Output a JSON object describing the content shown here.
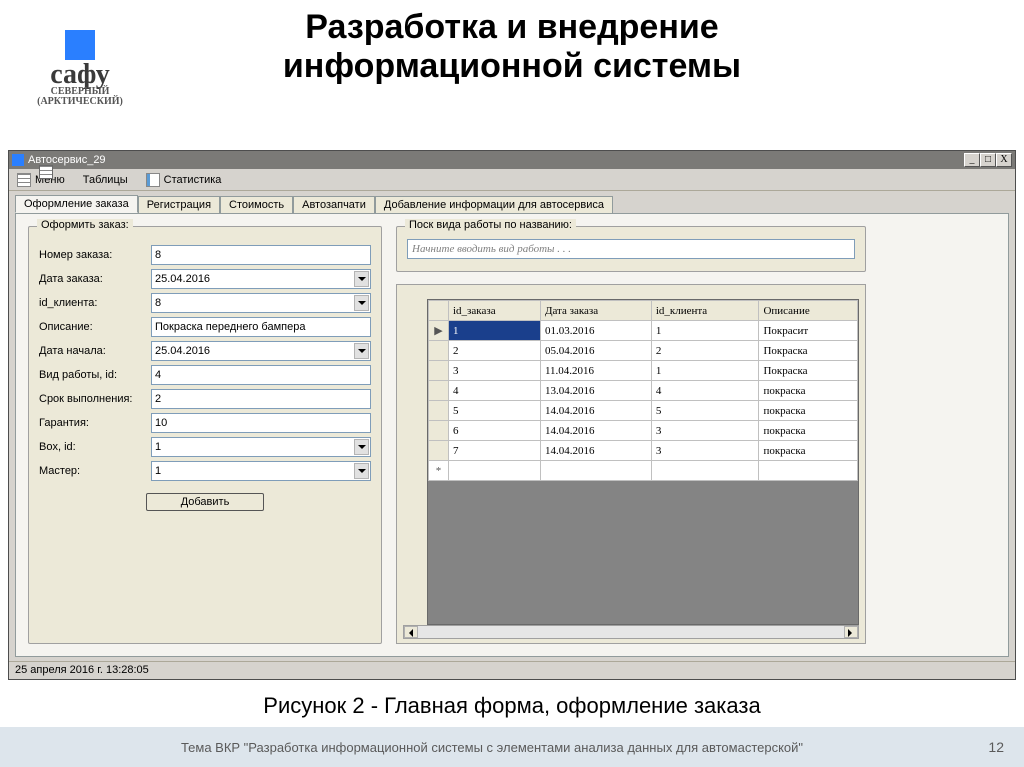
{
  "slide": {
    "title_line1": "Разработка и внедрение",
    "title_line2": "информационной системы",
    "caption": "Рисунок 2 - Главная форма, оформление заказа",
    "footer_topic": "Тема ВКР \"Разработка информационной системы с элементами анализа данных для автомастерской\"",
    "page_number": "12",
    "logo": {
      "brand": "сафу",
      "sub1": "СЕВЕРНЫЙ",
      "sub2": "(АРКТИЧЕСКИЙ)"
    }
  },
  "window": {
    "title": "Автосервис_29",
    "controls": {
      "min": "_",
      "max": "□",
      "close": "X"
    },
    "menu": {
      "items": [
        {
          "label": "Меню",
          "icon": "list"
        },
        {
          "label": "Таблицы",
          "icon": "grid"
        },
        {
          "label": "Статистика",
          "icon": "chart"
        }
      ]
    },
    "tabs": [
      {
        "label": "Оформление заказа",
        "active": true
      },
      {
        "label": "Регистрация",
        "active": false
      },
      {
        "label": "Стоимость",
        "active": false
      },
      {
        "label": "Автозапчати",
        "active": false
      },
      {
        "label": "Добавление информации для автосервиса",
        "active": false
      }
    ],
    "form": {
      "legend": "Оформить заказ:",
      "rows": [
        {
          "label": "Номер заказа:",
          "value": "8",
          "dropdown": false
        },
        {
          "label": "Дата заказа:",
          "value": "25.04.2016",
          "dropdown": true
        },
        {
          "label": "id_клиента:",
          "value": "8",
          "dropdown": true
        },
        {
          "label": "Описание:",
          "value": "Покраска переднего бампера",
          "dropdown": false
        },
        {
          "label": "Дата начала:",
          "value": "25.04.2016",
          "dropdown": true
        },
        {
          "label": "Вид работы, id:",
          "value": "4",
          "dropdown": false
        },
        {
          "label": "Срок выполнения:",
          "value": "2",
          "dropdown": false
        },
        {
          "label": "Гарантия:",
          "value": "10",
          "dropdown": false
        },
        {
          "label": "Box, id:",
          "value": "1",
          "dropdown": true
        },
        {
          "label": "Мастер:",
          "value": "1",
          "dropdown": true
        }
      ],
      "submit_label": "Добавить"
    },
    "search": {
      "legend": "Поск вида работы по названию:",
      "placeholder": "Начните вводить вид работы . . ."
    },
    "grid": {
      "headers": [
        "",
        "id_заказа",
        "Дата заказа",
        "id_клиента",
        "Описание"
      ],
      "rows": [
        {
          "marker": "▶",
          "id": "1",
          "date": "01.03.2016",
          "client": "1",
          "desc": "Покрасит",
          "selected": true
        },
        {
          "marker": "",
          "id": "2",
          "date": "05.04.2016",
          "client": "2",
          "desc": "Покраска"
        },
        {
          "marker": "",
          "id": "3",
          "date": "11.04.2016",
          "client": "1",
          "desc": "Покраска"
        },
        {
          "marker": "",
          "id": "4",
          "date": "13.04.2016",
          "client": "4",
          "desc": "покраска"
        },
        {
          "marker": "",
          "id": "5",
          "date": "14.04.2016",
          "client": "5",
          "desc": "покраска"
        },
        {
          "marker": "",
          "id": "6",
          "date": "14.04.2016",
          "client": "3",
          "desc": "покраска"
        },
        {
          "marker": "",
          "id": "7",
          "date": "14.04.2016",
          "client": "3",
          "desc": "покраска"
        }
      ],
      "new_row_marker": "*"
    },
    "statusbar": "25 апреля 2016 г.   13:28:05"
  }
}
